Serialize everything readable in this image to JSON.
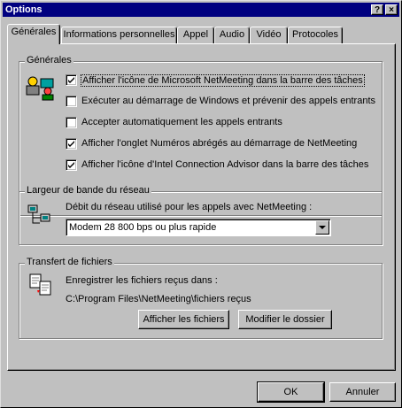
{
  "window": {
    "title": "Options",
    "help_glyph": "?",
    "close_glyph": "×"
  },
  "tabs": [
    {
      "label": "Générales",
      "active": true
    },
    {
      "label": "Informations personnelles",
      "active": false
    },
    {
      "label": "Appel",
      "active": false
    },
    {
      "label": "Audio",
      "active": false
    },
    {
      "label": "Vidéo",
      "active": false
    },
    {
      "label": "Protocoles",
      "active": false
    }
  ],
  "general": {
    "group_label": "Générales",
    "options": [
      {
        "label": "Afficher l'icône de Microsoft NetMeeting dans la barre des tâches",
        "checked": true
      },
      {
        "label": "Exécuter au démarrage de Windows et prévenir des appels entrants",
        "checked": false
      },
      {
        "label": "Accepter automatiquement les appels entrants",
        "checked": false
      },
      {
        "label": "Afficher l'onglet Numéros abrégés au démarrage de NetMeeting",
        "checked": true
      },
      {
        "label": "Afficher l'icône d'Intel Connection Advisor dans la barre des tâches",
        "checked": true
      }
    ]
  },
  "bandwidth": {
    "group_label": "Largeur de bande du réseau",
    "prompt": "Débit du réseau utilisé pour les appels avec NetMeeting :",
    "selected": "Modem 28 800 bps ou plus rapide"
  },
  "files": {
    "group_label": "Transfert de fichiers",
    "save_label": "Enregistrer les fichiers reçus dans :",
    "path": "C:\\Program Files\\NetMeeting\\fichiers reçus",
    "show_button": "Afficher les fichiers",
    "modify_button": "Modifier le dossier"
  },
  "footer": {
    "ok_label": "OK",
    "cancel_label": "Annuler"
  },
  "colors": {
    "titlebar": "#000080",
    "face": "#c0c0c0"
  }
}
